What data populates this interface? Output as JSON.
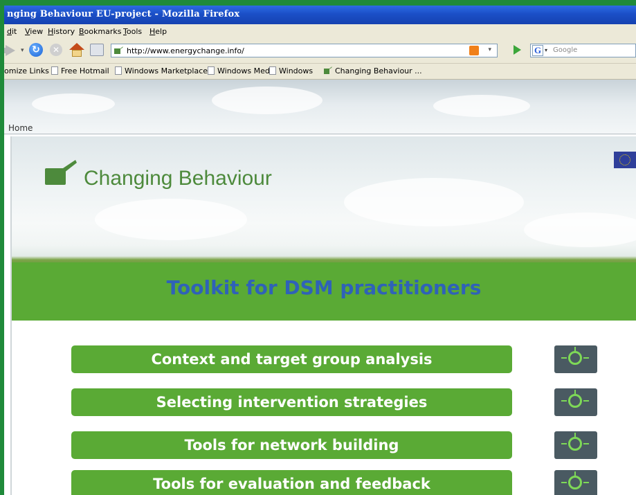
{
  "browser": {
    "title": "nging Behaviour EU-project - Mozilla Firefox",
    "menu": [
      "dit",
      "View",
      "History",
      "Bookmarks",
      "Tools",
      "Help"
    ],
    "url": "http://www.energychange.info/",
    "search_placeholder": "Google",
    "bookmarks": [
      "omize Links",
      "Free Hotmail",
      "Windows Marketplace",
      "Windows Media",
      "Windows",
      "Changing Behaviour ..."
    ]
  },
  "site": {
    "home_link": "Home",
    "brand": "Changing Behaviour",
    "toolkit_title": "Toolkit for DSM practitioners",
    "sections": [
      "Context and target group analysis",
      "Selecting intervention strategies",
      "Tools for network building",
      "Tools for evaluation and feedback"
    ]
  },
  "colors": {
    "accent_green": "#5aaa35",
    "title_blue": "#2f62b8",
    "brand_green": "#4d8a3c"
  },
  "icons": {
    "section_icon": "lightbulb-icon",
    "logo": "checkmark-leaf-logo",
    "flag": "eu-flag-icon"
  }
}
